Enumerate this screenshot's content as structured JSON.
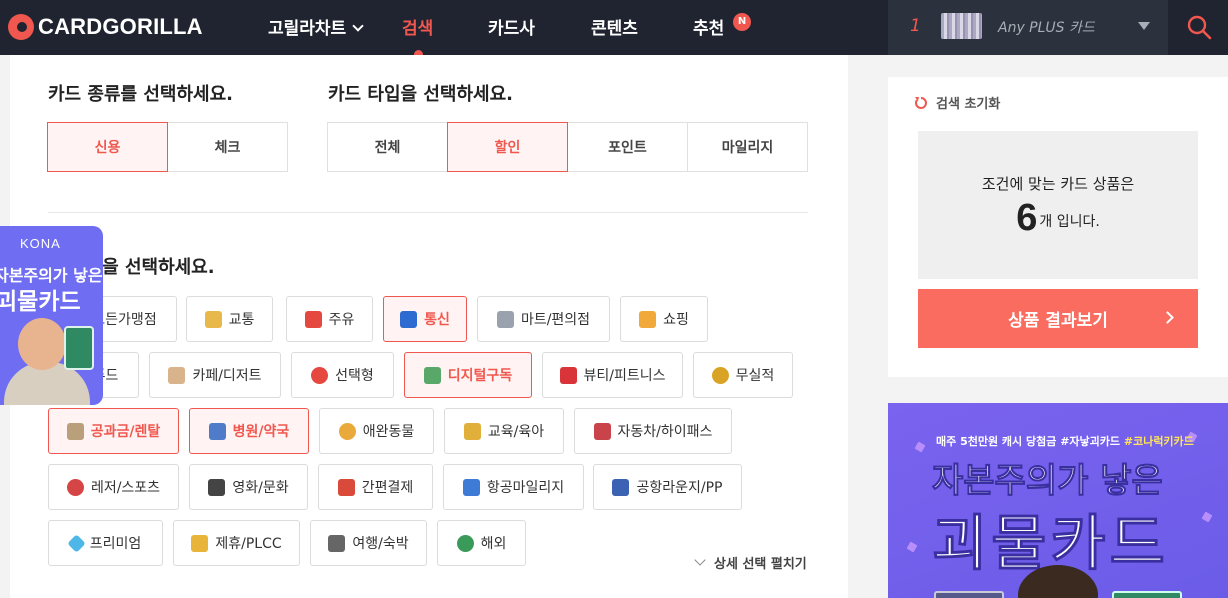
{
  "header": {
    "logo": "CARDGORILLA",
    "nav": [
      {
        "label": "고릴라차트",
        "dropdown": true
      },
      {
        "label": "검색",
        "active": true
      },
      {
        "label": "카드사"
      },
      {
        "label": "콘텐츠"
      },
      {
        "label": "추천",
        "badge": "N"
      }
    ],
    "ranking": {
      "rank": "1",
      "card_name": "Any PLUS 카드"
    }
  },
  "filters": {
    "kind_title": "카드 종류를 선택하세요.",
    "kind_options": [
      {
        "label": "신용",
        "selected": true
      },
      {
        "label": "체크",
        "selected": false
      }
    ],
    "type_title": "카드 타입을 선택하세요.",
    "type_options": [
      {
        "label": "전체",
        "selected": false
      },
      {
        "label": "할인",
        "selected": true
      },
      {
        "label": "포인트",
        "selected": false
      },
      {
        "label": "마일리지",
        "selected": false
      }
    ],
    "benefit_title": "혜택을 선택하세요.",
    "benefits": [
      {
        "label": "모든가맹점",
        "selected": false,
        "icon": "all-stores-icon",
        "color": "#7bb3e6"
      },
      {
        "label": "교통",
        "selected": false,
        "icon": "bus-icon",
        "color": "#e9b84a"
      },
      {
        "label": "주유",
        "selected": false,
        "icon": "fuel-icon",
        "color": "#e5483f"
      },
      {
        "label": "통신",
        "selected": true,
        "icon": "phone-icon",
        "color": "#2e6bd1"
      },
      {
        "label": "마트/편의점",
        "selected": false,
        "icon": "cart-icon",
        "color": "#9aa3ad"
      },
      {
        "label": "쇼핑",
        "selected": false,
        "icon": "gift-icon",
        "color": "#f2a93b"
      },
      {
        "label": "푸드",
        "selected": false,
        "icon": "food-icon",
        "color": "#e39b5b"
      },
      {
        "label": "카페/디저트",
        "selected": false,
        "icon": "cake-icon",
        "color": "#d9b38c"
      },
      {
        "label": "선택형",
        "selected": false,
        "icon": "target-icon",
        "color": "#e5483f"
      },
      {
        "label": "디지털구독",
        "selected": true,
        "icon": "tv-icon",
        "color": "#5aa869"
      },
      {
        "label": "뷰티/피트니스",
        "selected": false,
        "icon": "lipstick-icon",
        "color": "#d8343a"
      },
      {
        "label": "무실적",
        "selected": false,
        "icon": "medal-icon",
        "color": "#d9a425"
      },
      {
        "label": "공과금/렌탈",
        "selected": true,
        "icon": "receipt-icon",
        "color": "#b9a07a"
      },
      {
        "label": "병원/약국",
        "selected": true,
        "icon": "hospital-icon",
        "color": "#4f7cc9"
      },
      {
        "label": "애완동물",
        "selected": false,
        "icon": "cat-icon",
        "color": "#e9a93b"
      },
      {
        "label": "교육/육아",
        "selected": false,
        "icon": "pencil-icon",
        "color": "#e1b03a"
      },
      {
        "label": "자동차/하이패스",
        "selected": false,
        "icon": "car-icon",
        "color": "#c9444a"
      },
      {
        "label": "레저/스포츠",
        "selected": false,
        "icon": "ball-icon",
        "color": "#d64545"
      },
      {
        "label": "영화/문화",
        "selected": false,
        "icon": "clapper-icon",
        "color": "#444444"
      },
      {
        "label": "간편결제",
        "selected": false,
        "icon": "wallet-icon",
        "color": "#d94a3a"
      },
      {
        "label": "항공마일리지",
        "selected": false,
        "icon": "plane-icon",
        "color": "#3d7bd6"
      },
      {
        "label": "공항라운지/PP",
        "selected": false,
        "icon": "lounge-icon",
        "color": "#3b62b3"
      },
      {
        "label": "프리미엄",
        "selected": false,
        "icon": "diamond-icon",
        "color": "#4fb6e8"
      },
      {
        "label": "제휴/PLCC",
        "selected": false,
        "icon": "handshake-icon",
        "color": "#e8b43a"
      },
      {
        "label": "여행/숙박",
        "selected": false,
        "icon": "luggage-icon",
        "color": "#666666"
      },
      {
        "label": "해외",
        "selected": false,
        "icon": "globe-icon",
        "color": "#3a9a5a"
      }
    ],
    "expand_label": "상세 선택 펼치기"
  },
  "float_ad": {
    "brand": "KONA",
    "line1": "자본주의가 낳은",
    "line2": "괴물카드"
  },
  "side": {
    "reset_label": "검색 초기화",
    "count_text": "조건에 맞는 카드 상품은",
    "count": "6",
    "count_suffix": "개 입니다.",
    "result_button": "상품 결과보기"
  },
  "banner": {
    "top_text": "매주 5천만원 캐시 당첨금",
    "top_tag1": "#자낳괴카드",
    "top_tag2": "#코나럭키카드",
    "headline1": "자본주의가 낳은",
    "headline2": "괴물카드"
  },
  "colors": {
    "accent": "#f0574f",
    "header_bg": "#1f2430",
    "button": "#f96c5f",
    "banner_bg": "#7a63ee"
  }
}
